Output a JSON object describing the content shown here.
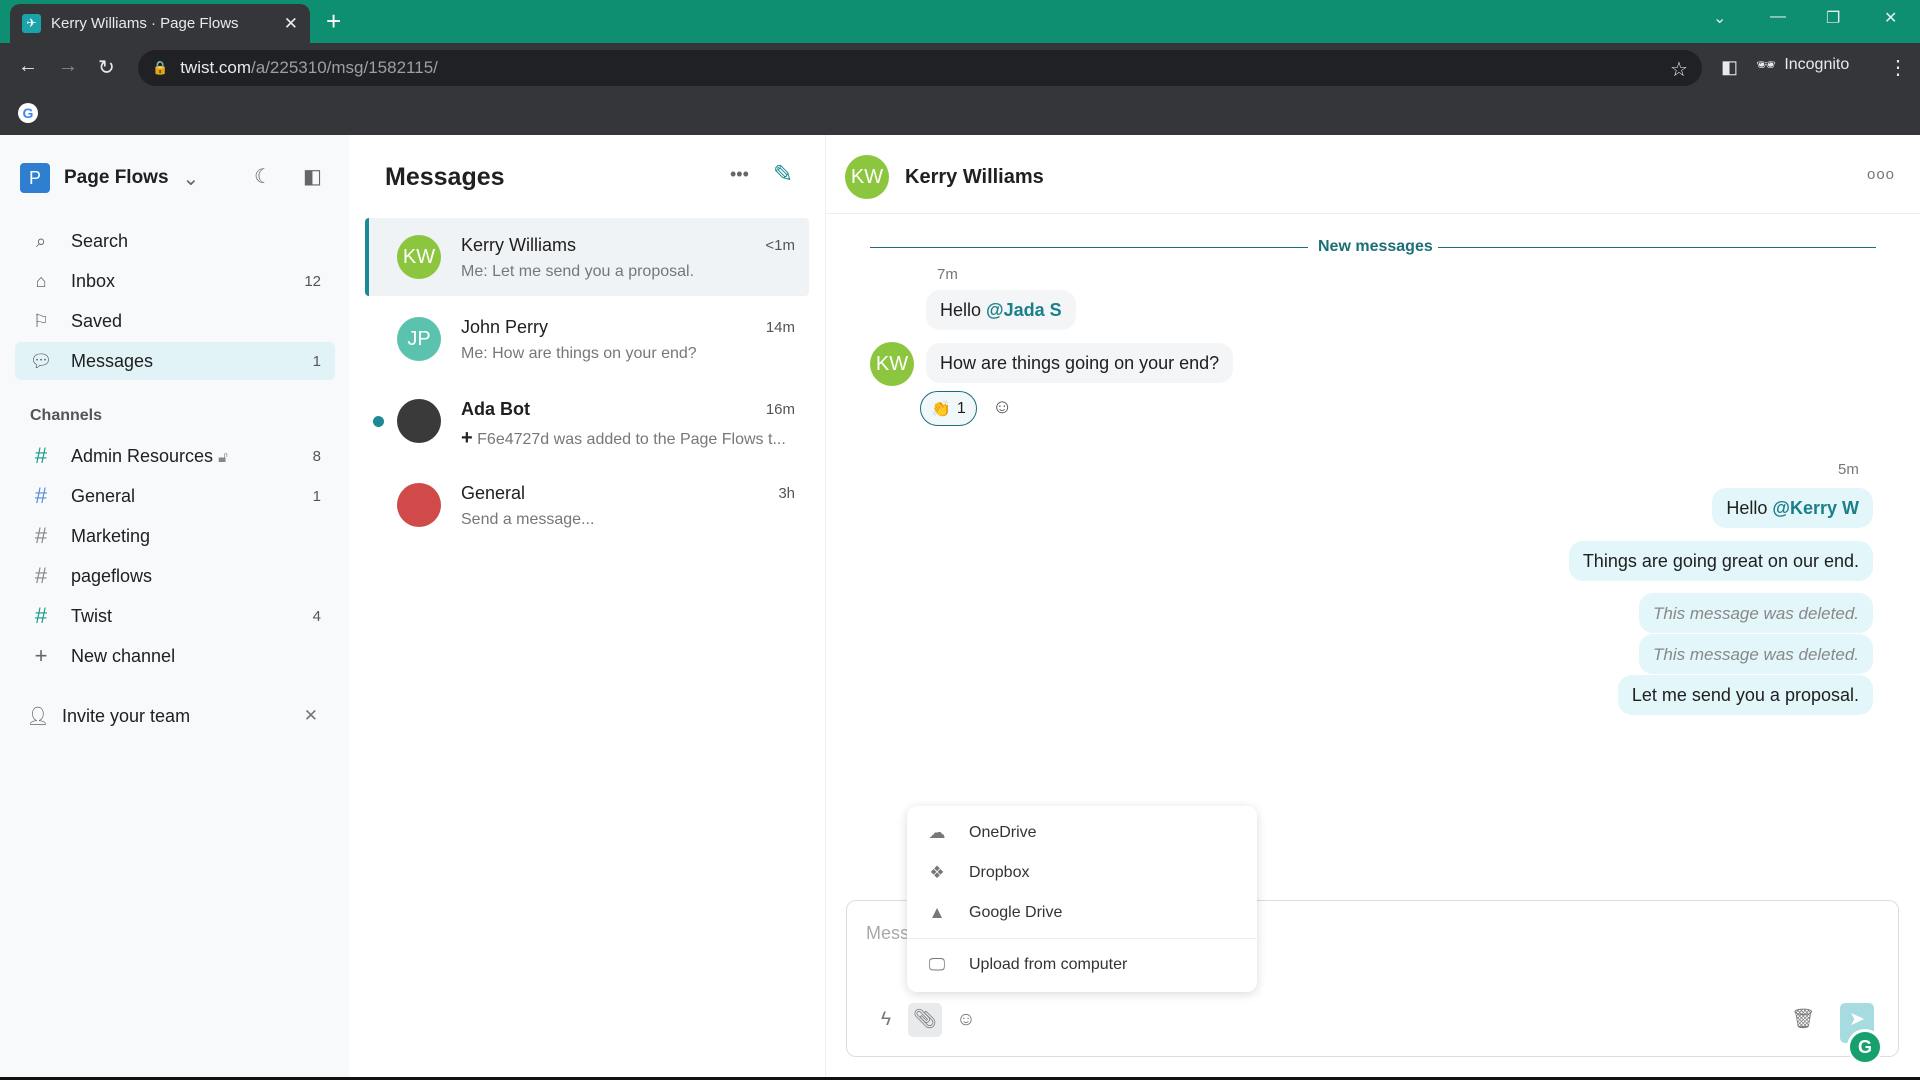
{
  "browser": {
    "tab_title": "Kerry Williams · Page Flows",
    "url_host": "twist.com",
    "url_path": "/a/225310/msg/1582115/",
    "profile": "Incognito"
  },
  "sidebar": {
    "workspace": "Page Flows",
    "workspace_initial": "P",
    "nav": [
      {
        "label": "Search",
        "icon": "search-icon"
      },
      {
        "label": "Inbox",
        "count": "12",
        "icon": "inbox-icon"
      },
      {
        "label": "Saved",
        "icon": "bookmark-icon"
      },
      {
        "label": "Messages",
        "count": "1",
        "icon": "chat-icon",
        "active": true
      }
    ],
    "channels_label": "Channels",
    "channels": [
      {
        "label": "Admin Resources",
        "count": "8",
        "locked": true
      },
      {
        "label": "General",
        "count": "1"
      },
      {
        "label": "Marketing"
      },
      {
        "label": "pageflows"
      },
      {
        "label": "Twist",
        "count": "4"
      }
    ],
    "new_channel": "New channel",
    "invite": "Invite your team"
  },
  "list": {
    "title": "Messages",
    "rows": [
      {
        "name": "Kerry Williams",
        "initials": "KW",
        "preview": "Me: Let me send you a proposal.",
        "time": "<1m",
        "color": "#8cc63f"
      },
      {
        "name": "John Perry",
        "initials": "JP",
        "preview": "Me: How are things on your end?",
        "time": "14m",
        "color": "#5cc2b0"
      },
      {
        "name": "Ada Bot",
        "initials": "",
        "preview": "F6e4727d was added to the Page Flows t...",
        "time": "16m",
        "color": "#3a3a3a",
        "unread": true
      },
      {
        "name": "General",
        "initials": "",
        "preview": "Send a message...",
        "time": "3h",
        "color": "#d04a4a"
      }
    ]
  },
  "chat": {
    "name": "Kerry Williams",
    "initials": "KW",
    "new_messages": "New messages",
    "left_time": "7m",
    "left_msgs": [
      {
        "text": "Hello ",
        "mention": "@Jada S"
      },
      {
        "text": "How are things going on your end?"
      }
    ],
    "reaction": {
      "emoji": "👏",
      "count": "1"
    },
    "right_time": "5m",
    "right_msgs": [
      {
        "text": "Hello ",
        "mention": "@Kerry W"
      },
      {
        "text": "Things are going great on our end."
      },
      {
        "text": "This message was deleted.",
        "deleted": true
      },
      {
        "text": "This message was deleted.",
        "deleted": true
      },
      {
        "text": "Let me send you a proposal."
      }
    ],
    "composer_placeholder": "Message",
    "menu": [
      "OneDrive",
      "Dropbox",
      "Google Drive",
      "Upload from computer"
    ]
  },
  "colors": {
    "accent": "#1b8a95",
    "tabbar": "#0f8f72"
  }
}
